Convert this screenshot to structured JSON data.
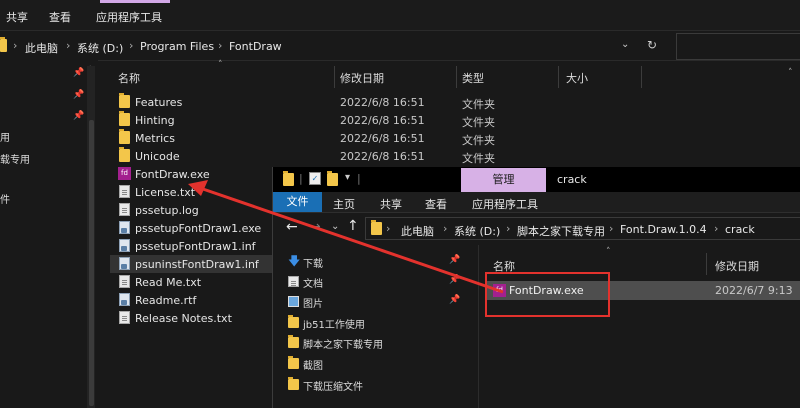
{
  "back_window": {
    "ribbon_tabs": [
      "共享",
      "查看",
      "应用程序工具"
    ],
    "breadcrumb": [
      "此电脑",
      "系统 (D:)",
      "Program Files",
      "FontDraw"
    ],
    "nav_fragments": [
      "用",
      "载专用",
      "件"
    ],
    "columns": {
      "name": "名称",
      "date": "修改日期",
      "type": "类型",
      "size": "大小"
    },
    "files": [
      {
        "name": "Features",
        "date": "2022/6/8 16:51",
        "type": "文件夹",
        "icon": "folder-icon"
      },
      {
        "name": "Hinting",
        "date": "2022/6/8 16:51",
        "type": "文件夹",
        "icon": "folder-icon"
      },
      {
        "name": "Metrics",
        "date": "2022/6/8 16:51",
        "type": "文件夹",
        "icon": "folder-icon"
      },
      {
        "name": "Unicode",
        "date": "2022/6/8 16:51",
        "type": "文件夹",
        "icon": "folder-icon"
      },
      {
        "name": "FontDraw.exe",
        "date": "",
        "type": "",
        "icon": "exe-icon"
      },
      {
        "name": "License.txt",
        "date": "",
        "type": "",
        "icon": "text-file-icon"
      },
      {
        "name": "pssetup.log",
        "date": "",
        "type": "",
        "icon": "text-file-icon"
      },
      {
        "name": "pssetupFontDraw1.exe",
        "date": "",
        "type": "",
        "icon": "setup-icon"
      },
      {
        "name": "pssetupFontDraw1.inf",
        "date": "",
        "type": "",
        "icon": "config-file-icon"
      },
      {
        "name": "psuninstFontDraw1.inf",
        "date": "",
        "type": "",
        "icon": "config-file-icon"
      },
      {
        "name": "Read Me.txt",
        "date": "",
        "type": "",
        "icon": "text-file-icon"
      },
      {
        "name": "Readme.rtf",
        "date": "",
        "type": "",
        "icon": "rtf-file-icon"
      },
      {
        "name": "Release Notes.txt",
        "date": "",
        "type": "",
        "icon": "text-file-icon"
      }
    ],
    "selected_file": "psuninstFontDraw1.inf"
  },
  "front_window": {
    "title": "crack",
    "manage_tab": "管理",
    "ribbon_tabs": [
      "文件",
      "主页",
      "共享",
      "查看",
      "应用程序工具"
    ],
    "breadcrumb": [
      "此电脑",
      "系统 (D:)",
      "脚本之家下载专用",
      "Font.Draw.1.0.4",
      "crack"
    ],
    "nav_items": [
      {
        "label": "下载",
        "icon": "download-icon"
      },
      {
        "label": "文档",
        "icon": "documents-icon"
      },
      {
        "label": "图片",
        "icon": "pictures-icon"
      },
      {
        "label": "jb51工作使用",
        "icon": "folder-icon"
      },
      {
        "label": "脚本之家下载专用",
        "icon": "folder-icon"
      },
      {
        "label": "截图",
        "icon": "folder-icon"
      },
      {
        "label": "下载压缩文件",
        "icon": "folder-icon"
      }
    ],
    "columns": {
      "name": "名称",
      "date": "修改日期"
    },
    "files": [
      {
        "name": "FontDraw.exe",
        "date": "2022/6/7 9:13",
        "icon": "exe-icon"
      }
    ]
  },
  "colors": {
    "accent_manage": "#d7b1e6",
    "file_tab": "#1a6fb5",
    "annotation": "#e3322d",
    "folder": "#f3c64a"
  }
}
